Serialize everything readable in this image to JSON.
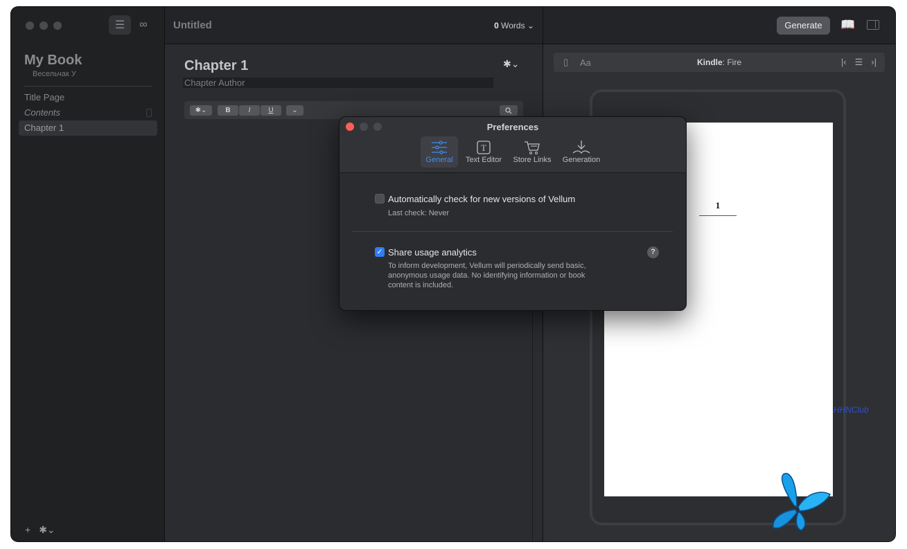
{
  "sidebar": {
    "book_title": "My Book",
    "book_author": "Весельчак У",
    "items": [
      {
        "label": "Title Page"
      },
      {
        "label": "Contents"
      },
      {
        "label": "Chapter 1"
      }
    ]
  },
  "editor": {
    "doc_title": "Untitled",
    "word_count_number": "0",
    "word_count_label": "Words",
    "chapter_title": "Chapter 1",
    "chapter_author_placeholder": "Chapter Author",
    "format_bold": "B",
    "format_italic": "I",
    "format_underline": "U"
  },
  "preview": {
    "generate_label": "Generate",
    "font_button": "Aa",
    "device_brand": "Kindle",
    "device_model": ": Fire",
    "page_number": "1",
    "watermark": "HHNClub"
  },
  "preferences": {
    "title": "Preferences",
    "tabs": [
      {
        "label": "General",
        "icon": "sliders-icon",
        "active": true
      },
      {
        "label": "Text Editor",
        "icon": "text-box-icon",
        "active": false
      },
      {
        "label": "Store Links",
        "icon": "cart-icon",
        "active": false
      },
      {
        "label": "Generation",
        "icon": "download-book-icon",
        "active": false
      }
    ],
    "auto_check_label": "Automatically check for new versions of Vellum",
    "auto_check_checked": false,
    "last_check": "Last check:  Never",
    "analytics_label": "Share usage analytics",
    "analytics_checked": true,
    "analytics_desc_1": "To inform development, Vellum will periodically send basic,",
    "analytics_desc_2": "anonymous usage data. No identifying information or book",
    "analytics_desc_3": "content is included.",
    "help": "?"
  },
  "colors": {
    "accent": "#2f7ef5",
    "close": "#fe5f57",
    "window_bg": "#2a2b2e"
  }
}
